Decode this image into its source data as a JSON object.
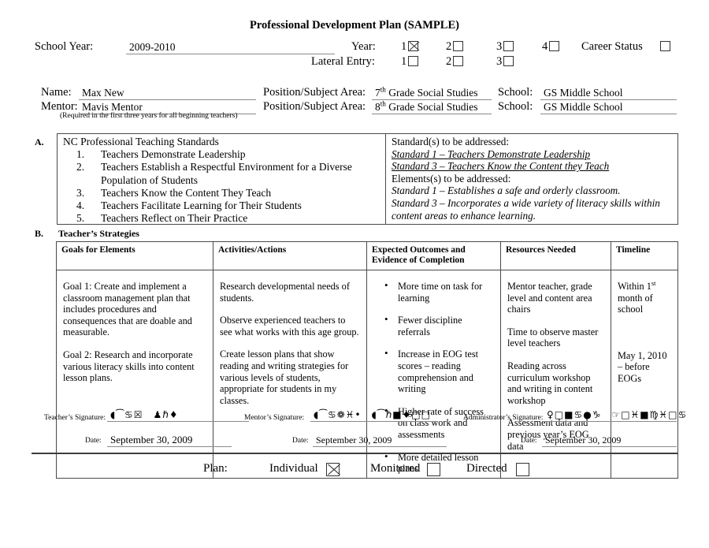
{
  "document": {
    "title": "Professional Development Plan (SAMPLE)"
  },
  "header": {
    "school_year_label": "School Year:",
    "school_year_value": "2009-2010",
    "year_label": "Year:",
    "lateral_entry_label": "Lateral Entry:",
    "year_options": [
      {
        "num": "1",
        "checked": true
      },
      {
        "num": "2",
        "checked": false
      },
      {
        "num": "3",
        "checked": false
      },
      {
        "num": "4",
        "checked": false
      }
    ],
    "lateral_entry_options": [
      {
        "num": "1",
        "checked": false
      },
      {
        "num": "2",
        "checked": false
      },
      {
        "num": "3",
        "checked": false
      }
    ],
    "career_status_label": "Career Status",
    "career_status_checked": false
  },
  "identity": {
    "name_label": "Name:",
    "name_value": "Max New",
    "mentor_label": "Mentor:",
    "mentor_value": "Mavis Mentor",
    "position_label_1": "Position/Subject Area:",
    "position_value_1_grade": "7",
    "position_value_1_ord": "th",
    "position_value_1_rest": " Grade Social Studies",
    "position_label_2": "Position/Subject Area:",
    "position_value_2_grade": "8",
    "position_value_2_ord": "th",
    "position_value_2_rest": " Grade Social Studies",
    "school_label_1": "School:",
    "school_value_1": "GS Middle School",
    "school_label_2": "School:",
    "school_value_2": "GS Middle School",
    "mentor_note": "(Required in the first three years for all beginning teachers)"
  },
  "section_a": {
    "letter": "A.",
    "standards_heading": "NC Professional Teaching Standards",
    "standards": [
      {
        "num": "1.",
        "text": "Teachers Demonstrate Leadership"
      },
      {
        "num": "2.",
        "text": "Teachers Establish a Respectful Environment for a Diverse Population of Students"
      },
      {
        "num": "3.",
        "text": "Teachers Know the Content They Teach"
      },
      {
        "num": "4.",
        "text": "Teachers Facilitate Learning for Their Students"
      },
      {
        "num": "5.",
        "text": "Teachers Reflect on Their Practice"
      }
    ],
    "standards_addressed_heading": "Standard(s) to be addressed:",
    "standards_addressed": [
      "Standard 1 – Teachers Demonstrate Leadership",
      "Standard 3 – Teachers Know the Content they Teach"
    ],
    "elements_addressed_heading": "Elements(s) to be addressed:",
    "elements_addressed": [
      "Standard 1 – Establishes a safe and orderly classroom.",
      "Standard 3 – Incorporates a wide variety of literacy skills within content areas to enhance learning."
    ]
  },
  "section_b": {
    "letter": "B.",
    "title": "Teacher’s Strategies",
    "columns": [
      "Goals for Elements",
      "Activities/Actions",
      "Expected Outcomes and Evidence of Completion",
      "Resources Needed",
      "Timeline"
    ],
    "goals": [
      "Goal 1:  Create and implement a classroom management plan that includes procedures and consequences that are doable and measurable.",
      "Goal 2:  Research and incorporate various literacy skills into content lesson plans."
    ],
    "activities": [
      "Research developmental needs of students.",
      "Observe experienced teachers to see what works with this age group.",
      "Create lesson plans that show reading and writing strategies for various levels of students, appropriate for students in my classes."
    ],
    "outcomes": [
      "More time on task for learning",
      "Fewer discipline referrals",
      "Increase in EOG test scores – reading comprehension and writing",
      "Higher rate of success on class work and assessments",
      "More detailed lesson plans"
    ],
    "resources": [
      "Mentor teacher, grade level and content area chairs",
      "Time to observe master level teachers",
      "Reading across curriculum workshop and writing in content workshop",
      "Assessment data and previous year’s EOG data"
    ],
    "timeline_1_pre": "Within 1",
    "timeline_1_ord": "st",
    "timeline_1_post": " month of school",
    "timeline_2": "May 1, 2010 – before EOGs"
  },
  "signatures": {
    "teacher_label": "Teacher’s Signature:",
    "teacher_glyphs": "◖⁀♋☒ ♟ℏ♦",
    "mentor_label": "Mentor’s Signature:",
    "mentor_glyphs": "◖⁀♋❁♓• ◖⁀ℏ■♦□□",
    "administrator_label": "Administrator’s Signature:",
    "administrator_glyphs": "♀□■♋●♑ ☞□♓■♍♓□♋",
    "date_label": "Date:",
    "teacher_date": "September 30, 2009",
    "mentor_date": "September 30, 2009",
    "administrator_date": "September 30, 2009"
  },
  "plan": {
    "label": "Plan:",
    "options": [
      {
        "label": "Individual",
        "checked": true
      },
      {
        "label": "Monitored",
        "checked": false
      },
      {
        "label": "Directed",
        "checked": false
      }
    ]
  }
}
